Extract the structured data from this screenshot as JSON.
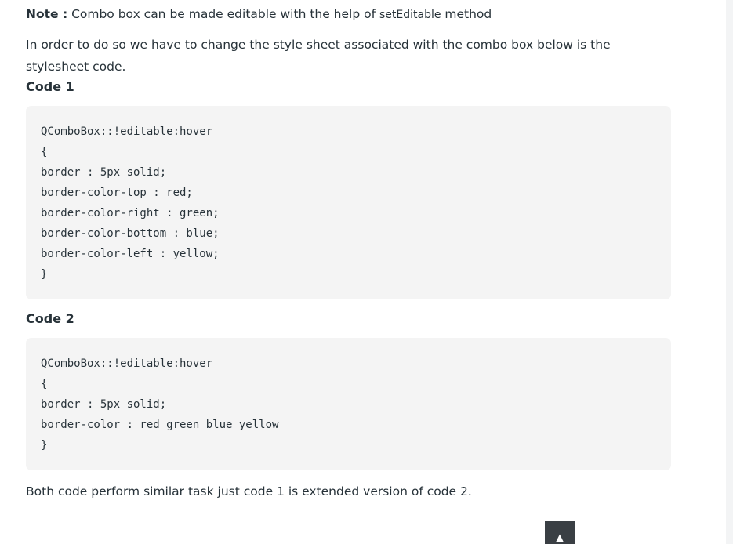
{
  "note": {
    "label": "Note :",
    "text_before": " Combo box can be made editable with the help of ",
    "inline_code": "setEditable",
    "text_after": " method"
  },
  "paragraph": "In order to do so we have to change the style sheet associated with the combo box below is the stylesheet code.",
  "code1": {
    "heading": "Code 1",
    "lines": [
      "QComboBox::!editable:hover",
      "{",
      "border : 5px solid;",
      "border-color-top : red;",
      "border-color-right : green;",
      "border-color-bottom : blue;",
      "border-color-left : yellow;",
      "}"
    ]
  },
  "code2": {
    "heading": "Code 2",
    "lines": [
      "QComboBox::!editable:hover",
      "{",
      "border : 5px solid;",
      "border-color : red green blue yellow",
      "}"
    ]
  },
  "footer": "Both code perform similar task just code 1 is extended version of code 2.",
  "scroll_top": {
    "icon": "triangle-up-icon",
    "glyph": "▲"
  }
}
